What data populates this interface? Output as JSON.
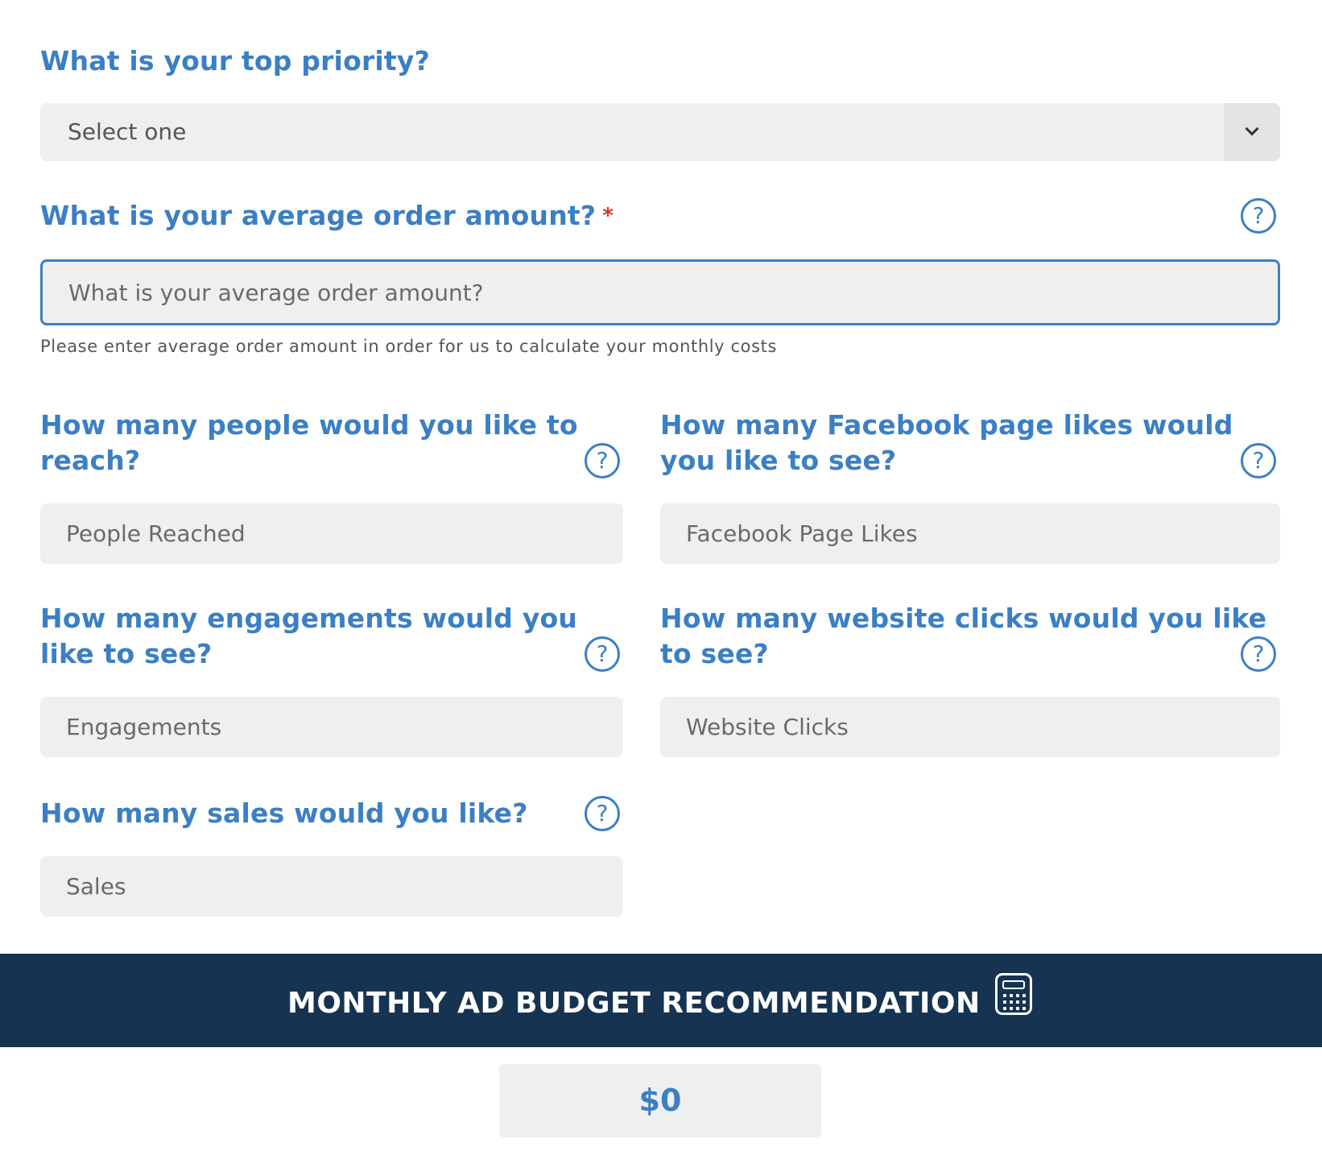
{
  "priority": {
    "label": "What is your top priority?",
    "selected": "Select one"
  },
  "order_amount": {
    "label": "What is your average order amount?",
    "required_mark": "*",
    "placeholder": "What is your average order amount?",
    "hint": "Please enter average order amount in order for us to calculate your monthly costs"
  },
  "people_reached": {
    "label_line1": "How many people would you like to",
    "label_line2": "reach?",
    "placeholder": "People Reached"
  },
  "page_likes": {
    "label_line1": "How many Facebook page likes would",
    "label_line2": "you like to see?",
    "placeholder": "Facebook Page Likes"
  },
  "engagements": {
    "label_line1": "How many engagements would you",
    "label_line2": "like to see?",
    "placeholder": "Engagements"
  },
  "website_clicks": {
    "label_line1": "How many website clicks would you like",
    "label_line2": "to see?",
    "placeholder": "Website Clicks"
  },
  "sales": {
    "label": "How many sales would you like?",
    "placeholder": "Sales"
  },
  "help_glyph": "?",
  "banner": {
    "title": "MONTHLY AD BUDGET RECOMMENDATION",
    "icon": "calculator-icon"
  },
  "result": {
    "value": "$0"
  },
  "colors": {
    "accent": "#3b7fc4",
    "banner_bg": "#163352",
    "field_bg": "#efeff0",
    "required": "#d9342b"
  }
}
